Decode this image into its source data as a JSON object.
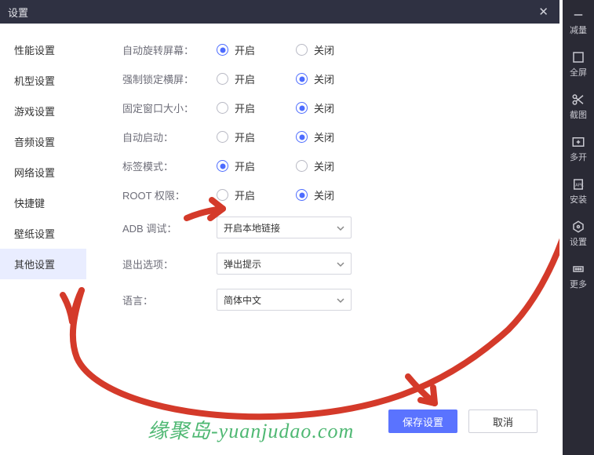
{
  "dialog": {
    "title": "设置",
    "close_glyph": "✕"
  },
  "side_nav": [
    "性能设置",
    "机型设置",
    "游戏设置",
    "音频设置",
    "网络设置",
    "快捷键",
    "壁纸设置",
    "其他设置"
  ],
  "side_nav_active": 7,
  "option_on": "开启",
  "option_off": "关闭",
  "rows": {
    "auto_rotate": {
      "label": "自动旋转屏幕：",
      "value": "on"
    },
    "force_landscape": {
      "label": "强制锁定横屏：",
      "value": "off"
    },
    "fixed_window": {
      "label": "固定窗口大小：",
      "value": "off"
    },
    "auto_start": {
      "label": "自动启动：",
      "value": "off"
    },
    "tab_mode": {
      "label": "标签模式：",
      "value": "on"
    },
    "root": {
      "label": "ROOT 权限：",
      "value": "off"
    },
    "adb": {
      "label": "ADB 调试：",
      "selected": "开启本地链接"
    },
    "exit": {
      "label": "退出选项：",
      "selected": "弹出提示"
    },
    "lang": {
      "label": "语言：",
      "selected": "简体中文"
    }
  },
  "buttons": {
    "save": "保存设置",
    "cancel": "取消"
  },
  "watermark": "缘聚岛-yuanjudao.com",
  "rail": {
    "reduce": "减量",
    "full": "全屏",
    "cut": "截图",
    "multi": "多开",
    "install": "安装",
    "settings": "设置",
    "more": "更多"
  }
}
